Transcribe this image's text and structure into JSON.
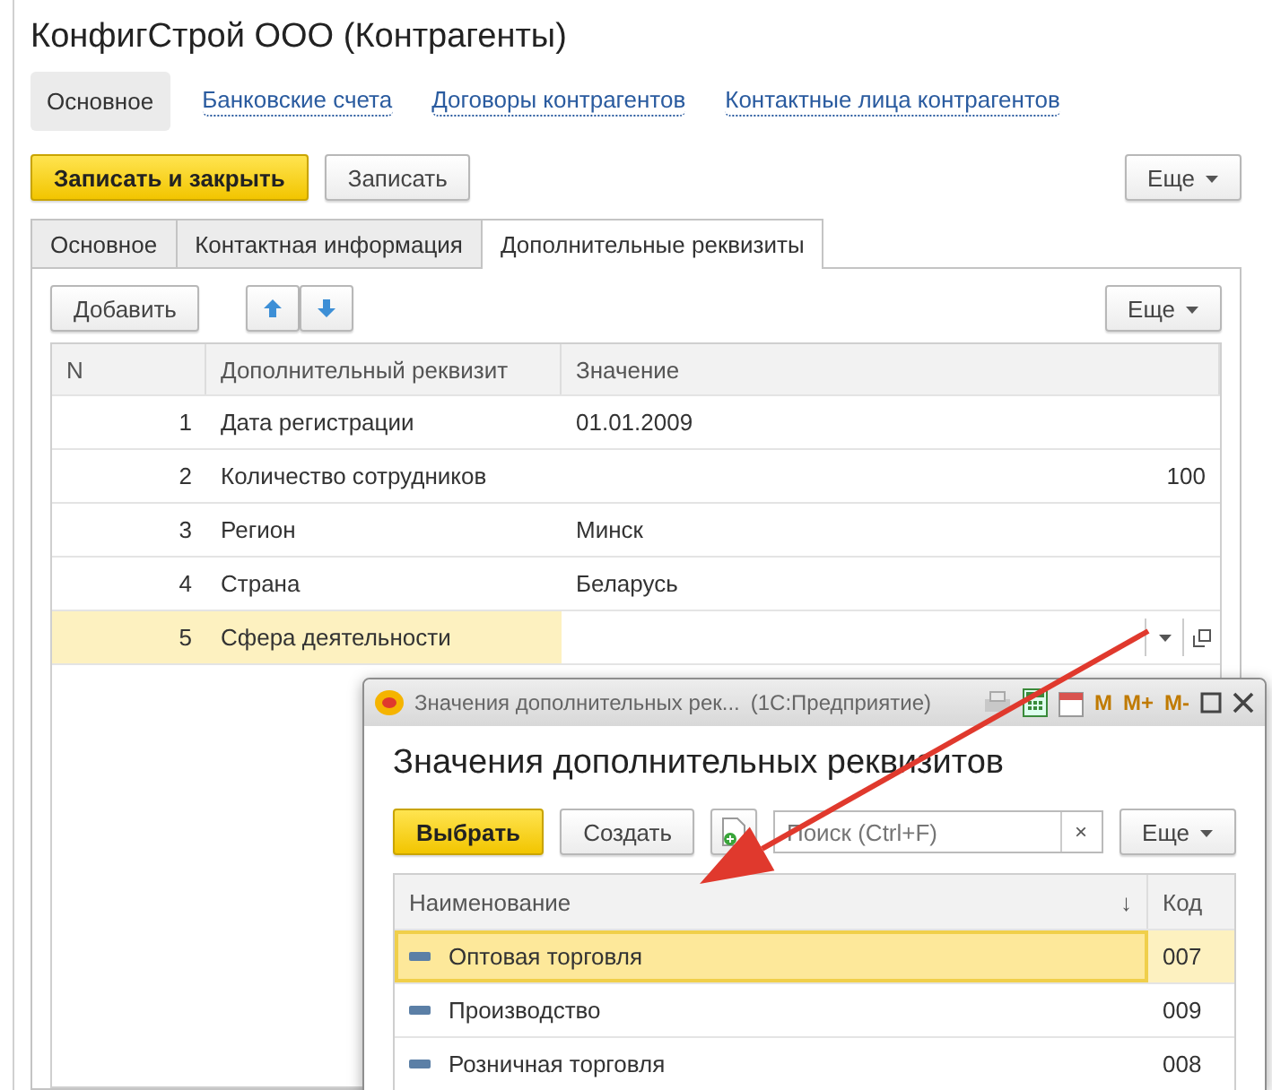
{
  "window": {
    "title": "КонфигСтрой ООО (Контрагенты)"
  },
  "nav": [
    {
      "label": "Основное",
      "selected": true
    },
    {
      "label": "Банковские счета",
      "selected": false
    },
    {
      "label": "Договоры контрагентов",
      "selected": false
    },
    {
      "label": "Контактные лица контрагентов",
      "selected": false
    }
  ],
  "commands": {
    "primary": "Записать и закрыть",
    "secondary": "Записать",
    "more": "Еще"
  },
  "tabs": [
    {
      "label": "Основное",
      "selected": false
    },
    {
      "label": "Контактная информация",
      "selected": false
    },
    {
      "label": "Дополнительные реквизиты",
      "selected": true
    }
  ],
  "table_toolbar": {
    "add": "Добавить",
    "more": "Еще"
  },
  "table": {
    "columns": [
      "N",
      "Дополнительный реквизит",
      "Значение"
    ],
    "rows": [
      {
        "n": "1",
        "name": "Дата регистрации",
        "value": "01.01.2009",
        "kind": "text",
        "selected": false
      },
      {
        "n": "2",
        "name": "Количество сотрудников",
        "value": "100",
        "kind": "number",
        "selected": false
      },
      {
        "n": "3",
        "name": "Регион",
        "value": "Минск",
        "kind": "text",
        "selected": false
      },
      {
        "n": "4",
        "name": "Страна",
        "value": "Беларусь",
        "kind": "text",
        "selected": false
      },
      {
        "n": "5",
        "name": "Сфера деятельности",
        "kind": "empty",
        "selected": true
      }
    ]
  },
  "popup": {
    "title": "Значения дополнительных рек...",
    "app": "(1С:Предприятие)",
    "memory_buttons": [
      "M",
      "M+",
      "M-"
    ],
    "heading": "Значения дополнительных реквизитов",
    "select": "Выбрать",
    "create": "Создать",
    "search": {
      "placeholder": "Поиск (Ctrl+F)",
      "clear": "×"
    },
    "more": "Еще",
    "table": {
      "columns": [
        "Наименование",
        "Код"
      ],
      "sort_mark": "↓",
      "rows": [
        {
          "name": "Оптовая торговля",
          "code": "007",
          "selected": true
        },
        {
          "name": "Производство",
          "code": "009",
          "selected": false
        },
        {
          "name": "Розничная торговля",
          "code": "008",
          "selected": false
        }
      ]
    }
  }
}
